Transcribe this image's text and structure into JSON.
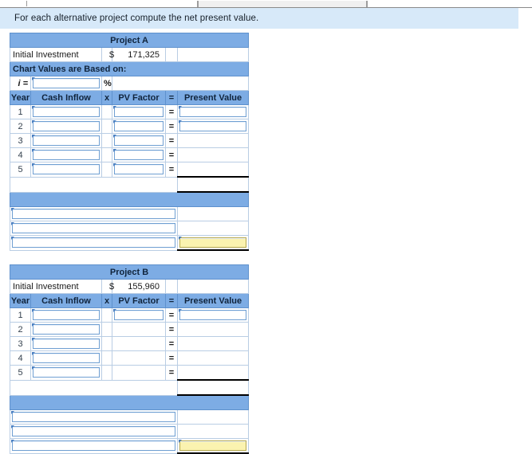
{
  "window": {
    "scrollbar": {
      "name": "horizontal-scrollbar"
    }
  },
  "instruction": {
    "text": "For each alternative project compute the net present value."
  },
  "columns": {
    "year": "Year",
    "cash_inflow": "Cash Inflow",
    "times": "x",
    "pv_factor": "PV Factor",
    "equals": "=",
    "present_value": "Present Value"
  },
  "labels": {
    "initial_investment": "Initial Investment",
    "chart_values_note": "Chart Values are Based on:",
    "interest_symbol": "i =",
    "percent": "%",
    "currency": "$",
    "empty": ""
  },
  "projects": [
    {
      "title": "Project A",
      "initial_investment": "171,325",
      "interest_rate": "",
      "rows": [
        {
          "year": "1",
          "cash_inflow": "",
          "pv_factor": "",
          "present_value": "",
          "has_pvf_input": true,
          "has_pv_input": true
        },
        {
          "year": "2",
          "cash_inflow": "",
          "pv_factor": "",
          "present_value": "",
          "has_pvf_input": true,
          "has_pv_input": true
        },
        {
          "year": "3",
          "cash_inflow": "",
          "pv_factor": "",
          "present_value": "",
          "has_pvf_input": true,
          "has_pv_input": false
        },
        {
          "year": "4",
          "cash_inflow": "",
          "pv_factor": "",
          "present_value": "",
          "has_pvf_input": true,
          "has_pv_input": false
        },
        {
          "year": "5",
          "cash_inflow": "",
          "pv_factor": "",
          "present_value": "",
          "has_pvf_input": true,
          "has_pv_input": false
        }
      ],
      "total_value": "",
      "summary_rows": [
        {
          "label": "",
          "value": "",
          "highlight": false
        },
        {
          "label": "",
          "value": "",
          "highlight": false
        },
        {
          "label": "",
          "value": "",
          "highlight": true
        }
      ]
    },
    {
      "title": "Project B",
      "initial_investment": "155,960",
      "interest_rate": null,
      "rows": [
        {
          "year": "1",
          "cash_inflow": "",
          "pv_factor": "",
          "present_value": "",
          "has_pvf_input": true,
          "has_pv_input": true
        },
        {
          "year": "2",
          "cash_inflow": "",
          "pv_factor": "",
          "present_value": "",
          "has_pvf_input": false,
          "has_pv_input": false
        },
        {
          "year": "3",
          "cash_inflow": "",
          "pv_factor": "",
          "present_value": "",
          "has_pvf_input": false,
          "has_pv_input": false
        },
        {
          "year": "4",
          "cash_inflow": "",
          "pv_factor": "",
          "present_value": "",
          "has_pvf_input": false,
          "has_pv_input": false
        },
        {
          "year": "5",
          "cash_inflow": "",
          "pv_factor": "",
          "present_value": "",
          "has_pvf_input": false,
          "has_pv_input": false
        }
      ],
      "total_value": "",
      "summary_rows": [
        {
          "label": "",
          "value": "",
          "highlight": false
        },
        {
          "label": "",
          "value": "",
          "highlight": false
        },
        {
          "label": "",
          "value": "",
          "highlight": true
        }
      ]
    }
  ],
  "colors": {
    "header_blue": "#7dace4",
    "banner_blue": "#d7e9f9",
    "input_border": "#6f9fd2",
    "highlight_yellow": "#fbf3b0"
  }
}
